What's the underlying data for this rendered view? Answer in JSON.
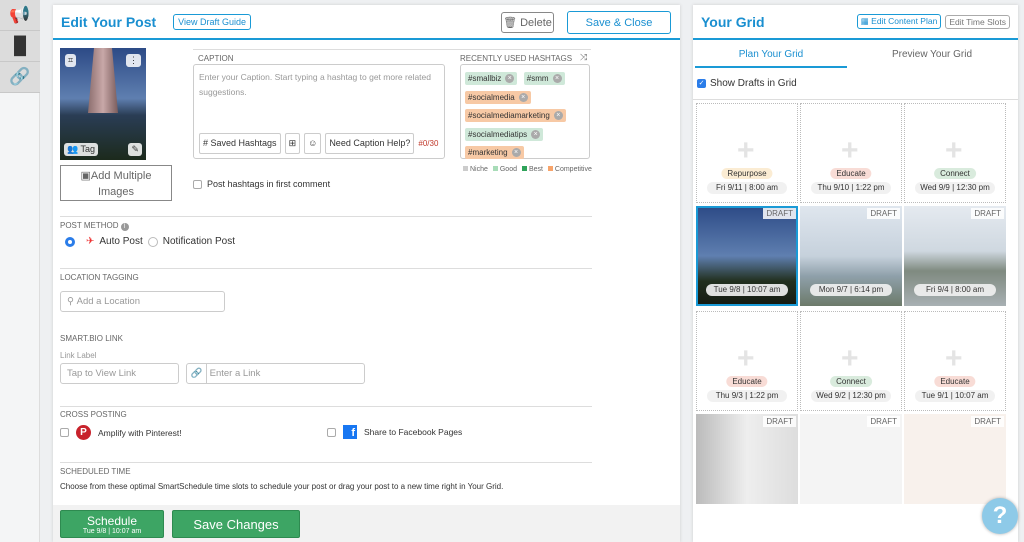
{
  "editor": {
    "title": "Edit Your Post",
    "draft_guide": "View Draft Guide",
    "delete": "Delete",
    "save_close": "Save & Close",
    "tag": "Tag",
    "add_multiple": "Add Multiple Images",
    "caption_label": "CAPTION",
    "caption_placeholder": "Enter your Caption. Start typing a hashtag to get more related suggestions.",
    "saved_hashtags": "Saved Hashtags",
    "caption_help": "Need Caption Help?",
    "char_count": "#0/30",
    "hashtags_label": "RECENTLY USED HASHTAGS",
    "hashtags": [
      {
        "text": "#smallbiz",
        "type": "good"
      },
      {
        "text": "#smm",
        "type": "good"
      },
      {
        "text": "#socialmedia",
        "type": "competitive"
      },
      {
        "text": "#socialmediamarketing",
        "type": "competitive"
      },
      {
        "text": "#socialmediatips",
        "type": "good"
      },
      {
        "text": "#marketing",
        "type": "competitive"
      }
    ],
    "legend": [
      "Niche",
      "Good",
      "Best",
      "Competitive"
    ],
    "first_comment": "Post hashtags in first comment",
    "post_method_label": "POST METHOD",
    "auto_post": "Auto Post",
    "notification_post": "Notification Post",
    "location_label": "LOCATION TAGGING",
    "location_placeholder": "Add a Location",
    "smartbio_label": "SMART.BIO LINK",
    "link_label": "Link Label",
    "link_label_placeholder": "Tap to View Link",
    "link_placeholder": "Enter a Link",
    "cross_label": "CROSS POSTING",
    "pinterest": "Amplify with Pinterest!",
    "facebook": "Share to Facebook Pages",
    "scheduled_label": "SCHEDULED TIME",
    "scheduled_text": "Choose from these optimal SmartSchedule time slots to schedule your post or drag your post to a new time right in Your Grid.",
    "schedule": "Schedule",
    "schedule_time": "Tue 9/8 | 10:07 am",
    "save_changes": "Save Changes"
  },
  "grid": {
    "title": "Your Grid",
    "edit_plan": "Edit Content Plan",
    "edit_slots": "Edit Time Slots",
    "tab_plan": "Plan Your Grid",
    "tab_preview": "Preview Your Grid",
    "show_drafts": "Show Drafts in Grid",
    "draft": "DRAFT",
    "cells": [
      {
        "kind": "empty",
        "tag": "Repurpose",
        "time": "Fri 9/11 | 8:00 am"
      },
      {
        "kind": "empty",
        "tag": "Educate",
        "time": "Thu 9/10 | 1:22 pm"
      },
      {
        "kind": "empty",
        "tag": "Connect",
        "time": "Wed 9/9 | 12:30 pm"
      },
      {
        "kind": "draft",
        "time": "Tue 9/8 | 10:07 am"
      },
      {
        "kind": "draft",
        "time": "Mon 9/7 | 6:14 pm"
      },
      {
        "kind": "draft",
        "time": "Fri 9/4 | 8:00 am"
      },
      {
        "kind": "empty",
        "tag": "Educate",
        "time": "Thu 9/3 | 1:22 pm"
      },
      {
        "kind": "empty",
        "tag": "Connect",
        "time": "Wed 9/2 | 12:30 pm"
      },
      {
        "kind": "empty",
        "tag": "Educate",
        "time": "Tue 9/1 | 10:07 am"
      }
    ]
  },
  "help": "?",
  "colors": {
    "accent": "#1a9ad6",
    "green": "#3da564",
    "good": "#cfe8d9",
    "competitive": "#f7c9a5"
  }
}
